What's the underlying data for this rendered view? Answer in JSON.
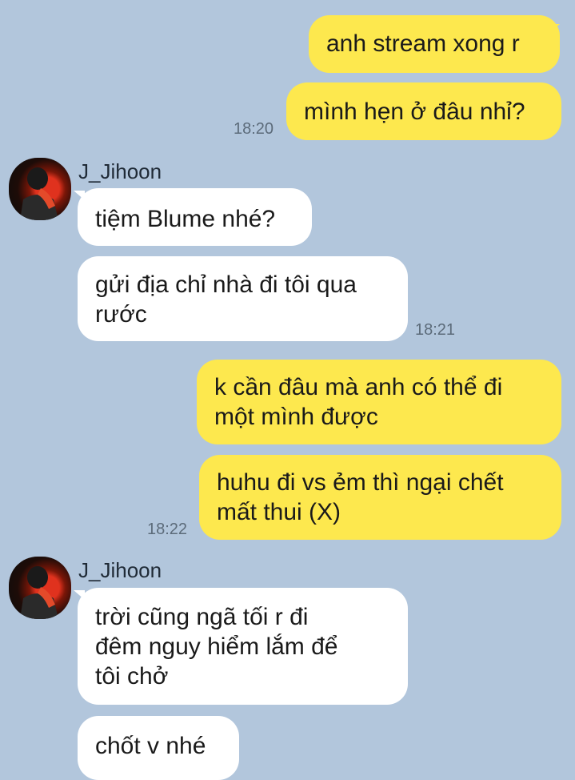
{
  "messages": [
    {
      "side": "out",
      "text": "anh stream xong r"
    },
    {
      "side": "out",
      "text": "mình hẹn ở đâu nhỉ?",
      "time": "18:20"
    },
    {
      "side": "in",
      "sender": "J_Jihoon",
      "text": "tiệm Blume nhé?"
    },
    {
      "side": "in",
      "text": "gửi địa chỉ nhà đi tôi qua\nrước",
      "time": "18:21"
    },
    {
      "side": "out",
      "text": "k cần đâu mà anh có thể đi\nmột mình được"
    },
    {
      "side": "out",
      "text": "huhu đi vs ẻm thì ngại chết\nmất thui (X)",
      "time": "18:22"
    },
    {
      "side": "in",
      "sender": "J_Jihoon",
      "text": "trời cũng ngã tối r đi\nđêm nguy hiểm lắm để\ntôi chở"
    },
    {
      "side": "in",
      "text": "chốt v nhé"
    }
  ],
  "colors": {
    "background": "#b2c6dc",
    "outgoing_bubble": "#fde84e",
    "incoming_bubble": "#ffffff"
  }
}
